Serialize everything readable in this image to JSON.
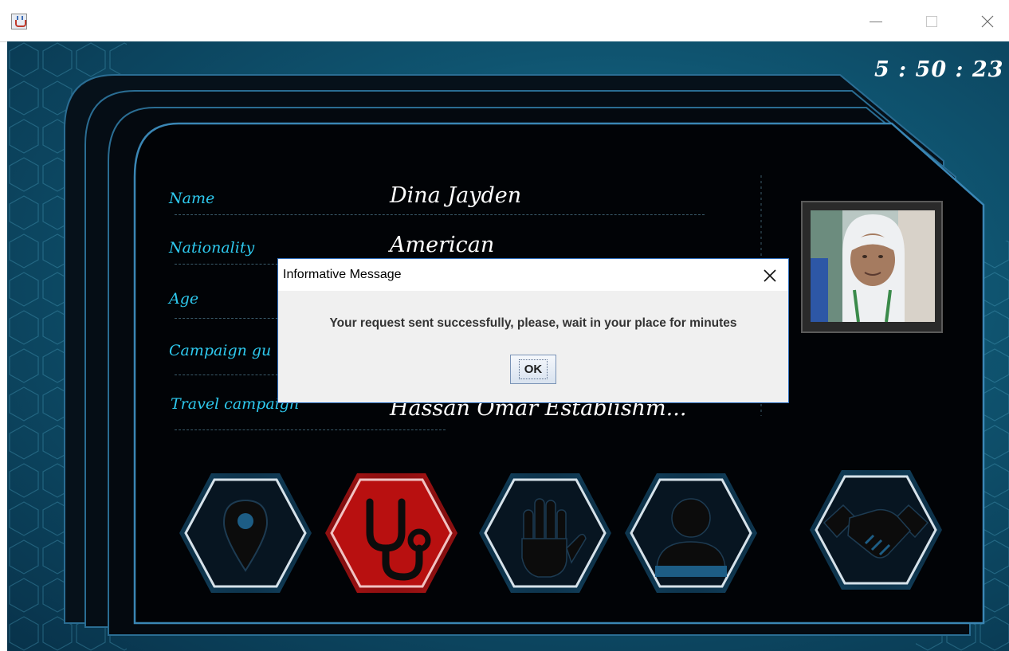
{
  "window": {
    "title": "",
    "icon": "java-app-icon",
    "controls": [
      "minimize-icon",
      "maximize-icon",
      "close-icon"
    ]
  },
  "clock": "5 : 50 : 23",
  "profile": {
    "fields": [
      {
        "label": "Name",
        "value": "Dina Jayden"
      },
      {
        "label": "Nationality",
        "value": "American"
      },
      {
        "label": "Age",
        "value": ""
      },
      {
        "label": "Campaign gu",
        "value": ""
      },
      {
        "label": "Travel campaign",
        "value": "Hassan Omar Establishm..."
      }
    ],
    "photo": "person-photo"
  },
  "actions": [
    {
      "name": "location-pin-icon",
      "color": "#1d6fa0"
    },
    {
      "name": "stethoscope-icon",
      "color": "#d11a1a"
    },
    {
      "name": "raised-hand-icon",
      "color": "#1d6fa0"
    },
    {
      "name": "user-icon",
      "color": "#1d6fa0"
    },
    {
      "name": "handshake-icon",
      "color": "#1d6fa0"
    }
  ],
  "dialog": {
    "title": "Informative Message",
    "message": "Your request sent successfully, please, wait in your place for minutes",
    "ok_label": "OK"
  },
  "colors": {
    "label": "#2ec9ee",
    "value": "#ffffff",
    "accent_red": "#d11a1a",
    "accent_blue": "#1d6fa0"
  }
}
